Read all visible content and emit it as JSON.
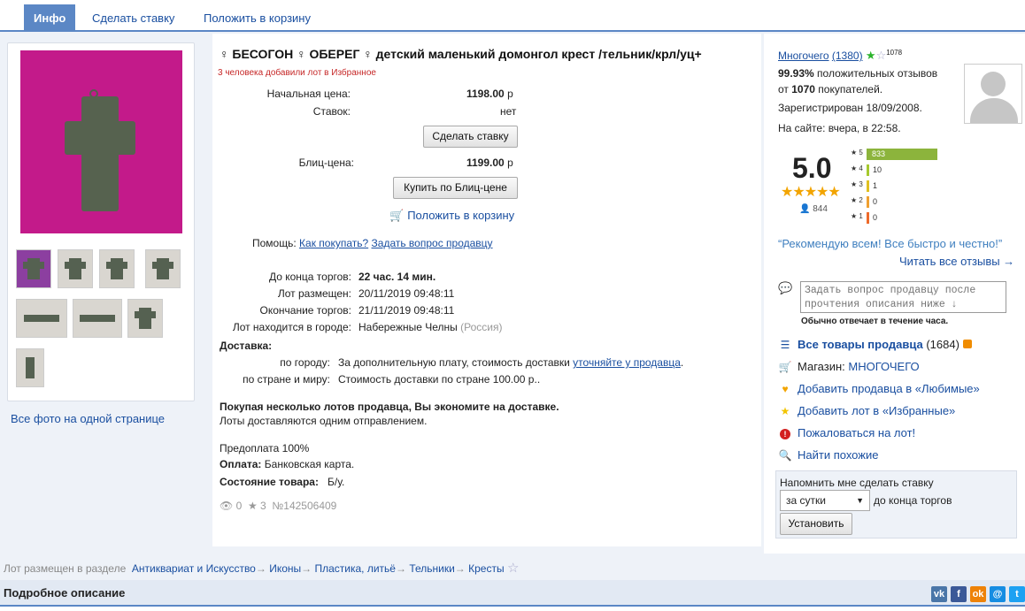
{
  "tabs": [
    "Инфо",
    "Сделать ставку",
    "Положить в корзину"
  ],
  "title": "♀ БЕСОГОН ♀ ОБЕРЕГ ♀ детский маленький домонгол крест /тельник/крл/уц+",
  "favorites_note": "3 человека добавили лот в Избранное",
  "price": {
    "start_label": "Начальная цена:",
    "start_value": "1198.00",
    "currency": "р",
    "bids_label": "Ставок:",
    "bids_value": "нет",
    "bid_button": "Сделать ставку",
    "blitz_label": "Блиц-цена:",
    "blitz_value": "1199.00",
    "blitz_button": "Купить по Блиц-цене",
    "cart_link": "Положить в корзину"
  },
  "help": {
    "label": "Помощь:",
    "how_to_buy": "Как покупать?",
    "ask_seller": "Задать вопрос продавцу"
  },
  "lot": {
    "ends_in_label": "До конца торгов:",
    "ends_in_value": "22 час. 14 мин.",
    "placed_label": "Лот размещен:",
    "placed_value": "20/11/2019 09:48:11",
    "end_label": "Окончание торгов:",
    "end_value": "21/11/2019 09:48:11",
    "city_label": "Лот находится в городе:",
    "city_value": "Набережные Челны",
    "country": "(Россия)"
  },
  "delivery": {
    "title": "Доставка:",
    "city_label": "по городу:",
    "city_text": "За дополнительную плату, стоимость доставки",
    "city_link": "уточняйте у продавца",
    "world_label": "по стране и миру:",
    "world_text": "Стоимость доставки по стране 100.00 р.."
  },
  "save_note": {
    "bold": "Покупая несколько лотов продавца, Вы экономите на доставке.",
    "text": "Лоты доставляются одним отправлением."
  },
  "payment": {
    "prepay": "Предоплата 100%",
    "pay_label": "Оплата:",
    "pay_value": "Банковская карта.",
    "cond_label": "Состояние товара:",
    "cond_value": "Б/у."
  },
  "stats": {
    "views": "0",
    "stars": "3",
    "lot_no": "№142506409"
  },
  "gallery": {
    "all_photos": "Все фото на одной странице"
  },
  "seller": {
    "name": "Многочего",
    "count": "(1380)",
    "sup": "1078",
    "positive_pct": "99.93%",
    "positive_text": "положительных отзывов",
    "from_text": "от",
    "buyers": "1070",
    "buyers_text": "покупателей.",
    "registered": "Зарегистрирован 18/09/2008.",
    "online": "На сайте: вчера, в 22:58.",
    "rating": "5.0",
    "reviews_count": "844",
    "bars": [
      {
        "label": "5",
        "count": "833",
        "fraction": 1.0,
        "color": "#8cb43c"
      },
      {
        "label": "4",
        "count": "10",
        "fraction": 0.04,
        "color": "#a6c92e"
      },
      {
        "label": "3",
        "count": "1",
        "fraction": 0.02,
        "color": "#e0c020"
      },
      {
        "label": "2",
        "count": "0",
        "fraction": 0.02,
        "color": "#f0a030"
      },
      {
        "label": "1",
        "count": "0",
        "fraction": 0.02,
        "color": "#ee6a2a"
      }
    ],
    "quote": "“Рекомендую всем! Все быстро и честно!”",
    "read_all": "Читать все отзывы →",
    "ask_placeholder": "Задать вопрос продавцу после прочтения описания ниже ↓",
    "reply_note": "Обычно отвечает в течение часа.",
    "all_goods": "Все товары продавца",
    "all_goods_count": "(1684)",
    "shop_label": "Магазин:",
    "shop_name": "МНОГОЧЕГО",
    "add_fav_seller": "Добавить продавца в «Любимые»",
    "add_fav_lot": "Добавить лот в «Избранные»",
    "complain": "Пожаловаться на лот!",
    "find_similar": "Найти похожие"
  },
  "remind": {
    "title": "Напомнить мне сделать ставку",
    "option": "за сутки",
    "suffix": "до конца торгов",
    "button": "Установить"
  },
  "category": {
    "label": "Лот размещен в разделе",
    "path": [
      "Антиквариат и Искусство",
      "Иконы",
      "Пластика, литьё",
      "Тельники",
      "Кресты"
    ]
  },
  "description": {
    "title": "Подробное описание"
  },
  "colors": {
    "accent": "#5b87c5",
    "link": "#1a4fa0",
    "photo_bg": "#c31a8a"
  }
}
